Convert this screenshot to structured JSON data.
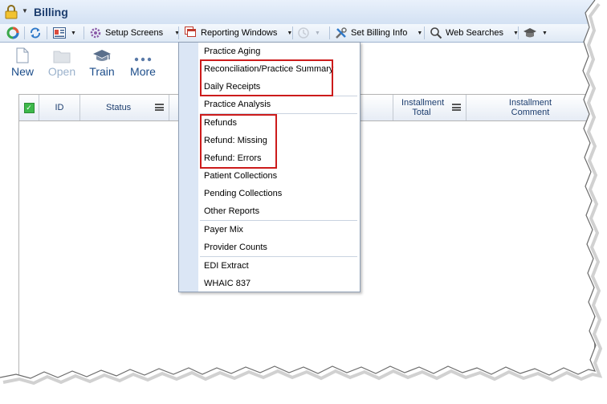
{
  "window": {
    "title": "Billing"
  },
  "toolbar": {
    "setup_screens": "Setup Screens",
    "reporting_windows": "Reporting Windows",
    "set_billing_info": "Set Billing Info",
    "web_searches": "Web Searches"
  },
  "ribbon": {
    "new": "New",
    "open": "Open",
    "train": "Train",
    "more": "More"
  },
  "grid": {
    "columns": [
      "ID",
      "Status",
      "Installment Total",
      "Installment Comment"
    ]
  },
  "menu": {
    "items": [
      "Practice Aging",
      "Reconciliation/Practice Summary",
      "Daily Receipts",
      "Practice Analysis",
      "Refunds",
      "Refund: Missing",
      "Refund: Errors",
      "Patient Collections",
      "Pending Collections",
      "Other Reports",
      "Payer Mix",
      "Provider Counts",
      "EDI Extract",
      "WHAIC 837"
    ]
  },
  "colors": {
    "highlight_box": "#cc1b1b",
    "title_text": "#1c3d6e",
    "menu_gutter": "#dbe6f5"
  },
  "icons": [
    "lock-icon",
    "chart-icon",
    "refresh-icon",
    "id-card-icon",
    "gear-icon",
    "windows-icon",
    "history-icon",
    "tools-icon",
    "search-icon",
    "graduation-cap-icon",
    "new-document-icon",
    "folder-icon",
    "ellipsis-icon",
    "checkbox-icon",
    "column-menu-icon"
  ]
}
